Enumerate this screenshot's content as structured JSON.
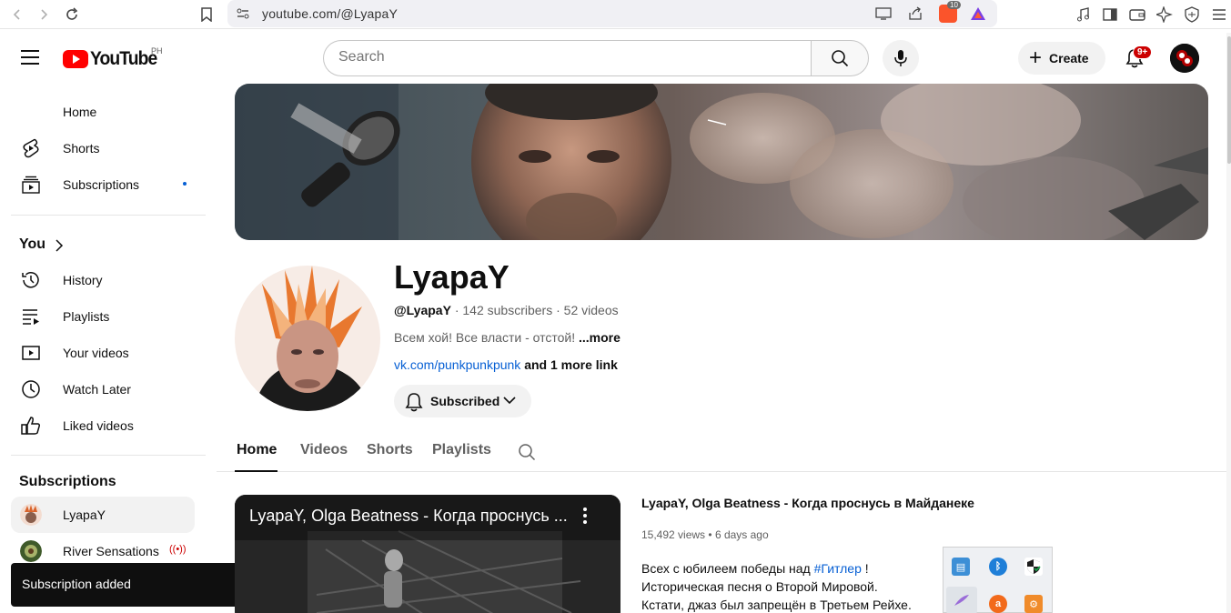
{
  "browser": {
    "url": "youtube.com/@LyapaY",
    "icons": [
      "back-icon",
      "forward-icon",
      "reload-icon",
      "bookmark-icon",
      "site-settings-icon",
      "cast-icon",
      "share-icon",
      "brave-shields-icon",
      "brave-rewards-icon",
      "music-icon",
      "sidebar-icon",
      "wallet-icon",
      "leo-ai-icon",
      "vpn-icon",
      "menu-icon"
    ],
    "shield_badge": "10"
  },
  "header": {
    "logo_text": "YouTube",
    "country_code": "PH",
    "search_placeholder": "Search",
    "create_label": "Create",
    "notifications_badge": "9+"
  },
  "sidebar": {
    "main": [
      {
        "label": "Home",
        "icon": "home-icon"
      },
      {
        "label": "Shorts",
        "icon": "shorts-icon"
      },
      {
        "label": "Subscriptions",
        "icon": "subscriptions-icon"
      }
    ],
    "you_heading": "You",
    "you_items": [
      {
        "label": "History",
        "icon": "history-icon"
      },
      {
        "label": "Playlists",
        "icon": "playlists-icon"
      },
      {
        "label": "Your videos",
        "icon": "your-videos-icon"
      },
      {
        "label": "Watch Later",
        "icon": "watch-later-icon"
      },
      {
        "label": "Liked videos",
        "icon": "liked-videos-icon"
      }
    ],
    "subscriptions_heading": "Subscriptions",
    "subscriptions": [
      {
        "label": "LyapaY",
        "active": true
      },
      {
        "label": "River Sensations",
        "live": true
      }
    ]
  },
  "toast": {
    "message": "Subscription added"
  },
  "channel": {
    "name": "LyapaY",
    "handle": "@LyapaY",
    "subscribers": "142 subscribers",
    "videos": "52 videos",
    "separator": "·",
    "description": "Всем хой! Все власти - отстой!",
    "more_label": "...more",
    "link": "vk.com/punkpunkpunk",
    "more_links": "and 1 more link",
    "subscribed_label": "Subscribed"
  },
  "tabs": [
    "Home",
    "Videos",
    "Shorts",
    "Playlists"
  ],
  "featured_video": {
    "overlay_title": "LyapaY, Olga Beatness - Когда проснусь ...",
    "title": "LyapaY, Olga Beatness - Когда проснусь в Майданеке",
    "views": "15,492 views",
    "age": "6 days ago",
    "meta_separator": "•",
    "desc_line1_before": "Всех с юбилеем победы над ",
    "desc_line1_tag": "#Гитлер",
    "desc_line1_after": " !",
    "desc_line2": "Историческая песня о Второй Мировой.",
    "desc_line3": "Кстати, джаз был запрещён в Третьем Рейхе."
  },
  "colors": {
    "youtube_red": "#ff0000",
    "link_blue": "#065fd4",
    "text_primary": "#0f0f0f",
    "text_secondary": "#606060"
  }
}
